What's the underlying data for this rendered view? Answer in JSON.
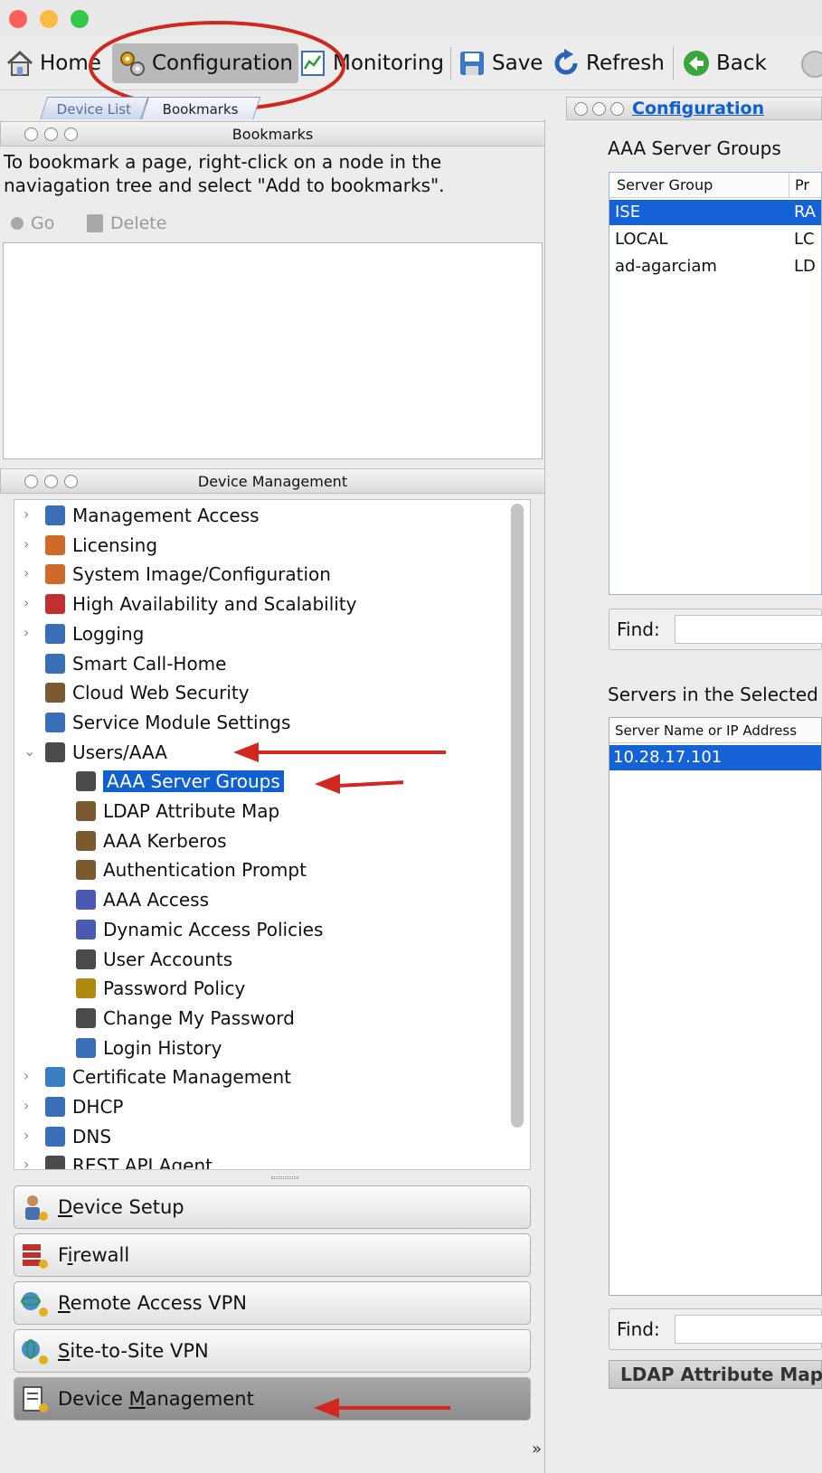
{
  "toolbar": {
    "home": "Home",
    "configuration": "Configuration",
    "monitoring": "Monitoring",
    "save": "Save",
    "refresh": "Refresh",
    "back": "Back"
  },
  "left_tabs": [
    "Device List",
    "Bookmarks"
  ],
  "bookmarks": {
    "title": "Bookmarks",
    "instructions_line1": "To bookmark a page, right-click on a node in the",
    "instructions_line2": "naviagation tree and select \"Add to bookmarks\".",
    "go": "Go",
    "delete": "Delete"
  },
  "device_management": {
    "title": "Device Management",
    "tree": [
      {
        "label": "Management Access",
        "expandable": true
      },
      {
        "label": "Licensing",
        "expandable": true
      },
      {
        "label": "System Image/Configuration",
        "expandable": true
      },
      {
        "label": "High Availability and Scalability",
        "expandable": true
      },
      {
        "label": "Logging",
        "expandable": true
      },
      {
        "label": "Smart Call-Home",
        "expandable": false
      },
      {
        "label": "Cloud Web Security",
        "expandable": false
      },
      {
        "label": "Service Module Settings",
        "expandable": false
      },
      {
        "label": "Users/AAA",
        "expandable": true
      },
      {
        "label": "AAA Server Groups",
        "expandable": false
      },
      {
        "label": "LDAP Attribute Map",
        "expandable": false
      },
      {
        "label": "AAA Kerberos",
        "expandable": false
      },
      {
        "label": "Authentication Prompt",
        "expandable": false
      },
      {
        "label": "AAA Access",
        "expandable": false
      },
      {
        "label": "Dynamic Access Policies",
        "expandable": false
      },
      {
        "label": "User Accounts",
        "expandable": false
      },
      {
        "label": "Password Policy",
        "expandable": false
      },
      {
        "label": "Change My Password",
        "expandable": false
      },
      {
        "label": "Login History",
        "expandable": false
      },
      {
        "label": "Certificate Management",
        "expandable": true
      },
      {
        "label": "DHCP",
        "expandable": true
      },
      {
        "label": "DNS",
        "expandable": true
      },
      {
        "label": "REST API Agent",
        "expandable": true
      }
    ]
  },
  "nav_buttons": [
    {
      "label": "Device Setup",
      "mnemonic": "D"
    },
    {
      "label": "Firewall",
      "mnemonic": "i"
    },
    {
      "label": "Remote Access VPN",
      "mnemonic": "R"
    },
    {
      "label": "Site-to-Site VPN",
      "mnemonic": "S"
    },
    {
      "label": "Device Management",
      "mnemonic": "M"
    }
  ],
  "right": {
    "breadcrumb": "Configuration",
    "server_groups_title": "AAA Server Groups",
    "columns": [
      "Server Group",
      "Pr"
    ],
    "rows": [
      {
        "group": "ISE",
        "protocol": "RA"
      },
      {
        "group": "LOCAL",
        "protocol": "LC"
      },
      {
        "group": "ad-agarciam",
        "protocol": "LD"
      }
    ],
    "find_label": "Find:",
    "servers_title": "Servers in the Selected",
    "servers_column": "Server Name or IP Address",
    "servers": [
      "10.28.17.101"
    ],
    "find_label2": "Find:",
    "ldap_bar": "LDAP Attribute Map"
  },
  "colors": {
    "selection": "#1462d6",
    "annotation_red": "#d0281e",
    "link_blue": "#1060d0"
  }
}
